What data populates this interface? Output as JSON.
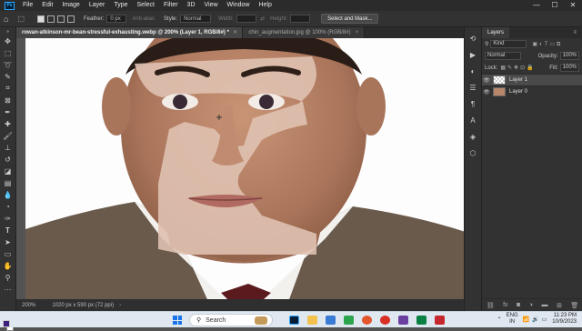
{
  "app": {
    "logo": "Ps"
  },
  "menu": [
    "File",
    "Edit",
    "Image",
    "Layer",
    "Type",
    "Select",
    "Filter",
    "3D",
    "View",
    "Window",
    "Help"
  ],
  "window_controls": {
    "minimize": "—",
    "maximize": "☐",
    "close": "✕"
  },
  "options": {
    "feather_label": "Feather:",
    "feather_value": "0 px",
    "antialias_label": "Anti-alias",
    "style_label": "Style:",
    "style_value": "Normal",
    "width_label": "Width:",
    "height_label": "Height:",
    "select_mask_label": "Select and Mask..."
  },
  "tabs": [
    {
      "label": "rowan-atkinson-mr-bean-stressful-exhausting.webp @ 200% (Layer 1, RGB/8#) *",
      "close": "×"
    },
    {
      "label": "chin_augmentation.jpg @ 100% (RGB/8#)",
      "close": "×"
    }
  ],
  "status": {
    "zoom": "200%",
    "doc": "1020 px x 590 px (72 ppi)",
    "arrow": "›"
  },
  "layers_panel": {
    "tab": "Layers",
    "kind_label": "Kind",
    "blend_mode": "Normal",
    "opacity_label": "Opacity:",
    "opacity_value": "100%",
    "lock_label": "Lock:",
    "fill_label": "Fill:",
    "fill_value": "100%",
    "layers": [
      {
        "name": "Layer 1",
        "selected": true
      },
      {
        "name": "Layer 0",
        "selected": false
      }
    ]
  },
  "taskbar": {
    "search_placeholder": "Search",
    "lang_top": "ENG",
    "lang_bottom": "IN",
    "time": "11:23 PM",
    "date": "10/9/2023"
  },
  "colors": {
    "foreground": "#3b1f7c",
    "background": "#ffffff",
    "ps_blue": "#31a8ff"
  }
}
